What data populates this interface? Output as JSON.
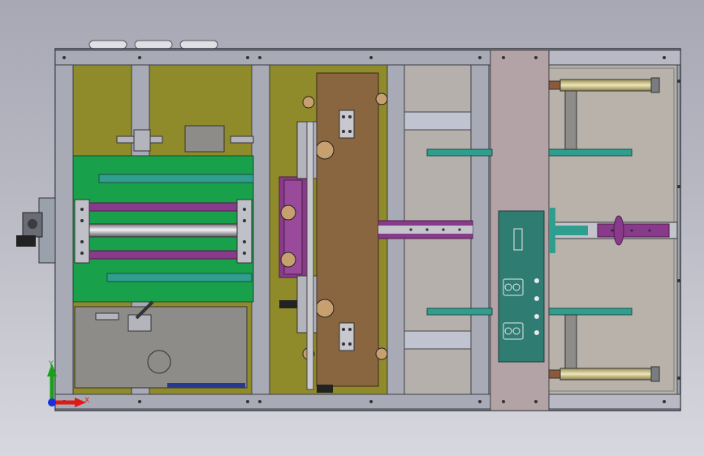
{
  "triad": {
    "x_label": "X",
    "y_label": "Y",
    "x_color": "#e01818",
    "y_color": "#18a018",
    "z_color": "#1a2ee0"
  },
  "colors": {
    "frame": "#9aa0ac",
    "frame_dark": "#3a3d44",
    "olive": "#8f8b2a",
    "green": "#18a04a",
    "teal": "#2f9e8e",
    "purple": "#8a3a8a",
    "brown": "#8a6640",
    "grey_plate": "#8e8c88",
    "mauve_panel": "#b4a3a6",
    "cabinet": "#b8b2aa",
    "steel": "#c4c4cc",
    "yellow_rod": "#d2c690",
    "control_box": "#2f7c73"
  }
}
